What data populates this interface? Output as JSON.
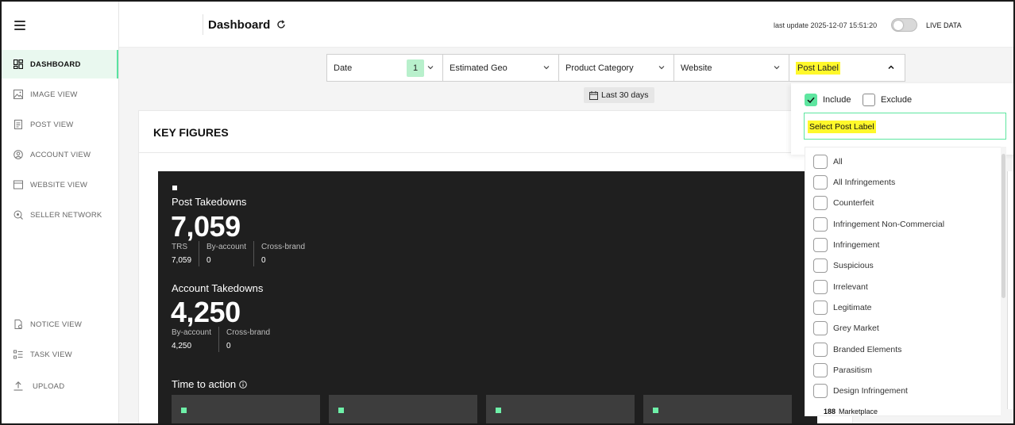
{
  "header": {
    "title": "Dashboard",
    "last_update": "last update 2025-12-07 15:51:20",
    "live_label": "LIVE DATA"
  },
  "sidebar": {
    "items": [
      {
        "label": "DASHBOARD",
        "icon": "dashboard-icon"
      },
      {
        "label": "IMAGE VIEW",
        "icon": "image-icon"
      },
      {
        "label": "POST VIEW",
        "icon": "post-icon"
      },
      {
        "label": "ACCOUNT VIEW",
        "icon": "account-icon"
      },
      {
        "label": "WEBSITE VIEW",
        "icon": "website-icon"
      },
      {
        "label": "SELLER NETWORK",
        "icon": "seller-network-icon"
      },
      {
        "label": "NOTICE VIEW",
        "icon": "notice-icon"
      },
      {
        "label": "TASK VIEW",
        "icon": "task-icon"
      },
      {
        "label": "UPLOAD",
        "icon": "upload-icon"
      }
    ]
  },
  "filters": {
    "date": "Date",
    "date_count": "1",
    "geo": "Estimated Geo",
    "category": "Product Category",
    "website": "Website",
    "post_label": "Post Label",
    "range": "Last 30 days"
  },
  "key_figures": {
    "title": "KEY FIGURES",
    "post_takedowns": {
      "label": "Post Takedowns",
      "value": "7,059",
      "breakdown": [
        {
          "label": "TRS",
          "value": "7,059"
        },
        {
          "label": "By-account",
          "value": "0"
        },
        {
          "label": "Cross-brand",
          "value": "0"
        }
      ]
    },
    "account_takedowns": {
      "label": "Account Takedowns",
      "value": "4,250",
      "breakdown": [
        {
          "label": "By-account",
          "value": "4,250"
        },
        {
          "label": "Cross-brand",
          "value": "0"
        }
      ]
    },
    "time_to_action": "Time to action"
  },
  "dropdown": {
    "include": "Include",
    "exclude": "Exclude",
    "search_placeholder": "Select Post Label",
    "options": [
      "All",
      "All Infringements",
      "Counterfeit",
      "Infringement Non-Commercial",
      "Infringement",
      "Suspicious",
      "Irrelevant",
      "Legitimate",
      "Grey Market",
      "Branded Elements",
      "Parasitism",
      "Design Infringement"
    ],
    "peek_count": "188",
    "peek_label": "Marketplace"
  },
  "colors": {
    "accent": "#5ee6a0",
    "highlight": "#fff82b",
    "dark_panel": "#1f1f1f"
  }
}
